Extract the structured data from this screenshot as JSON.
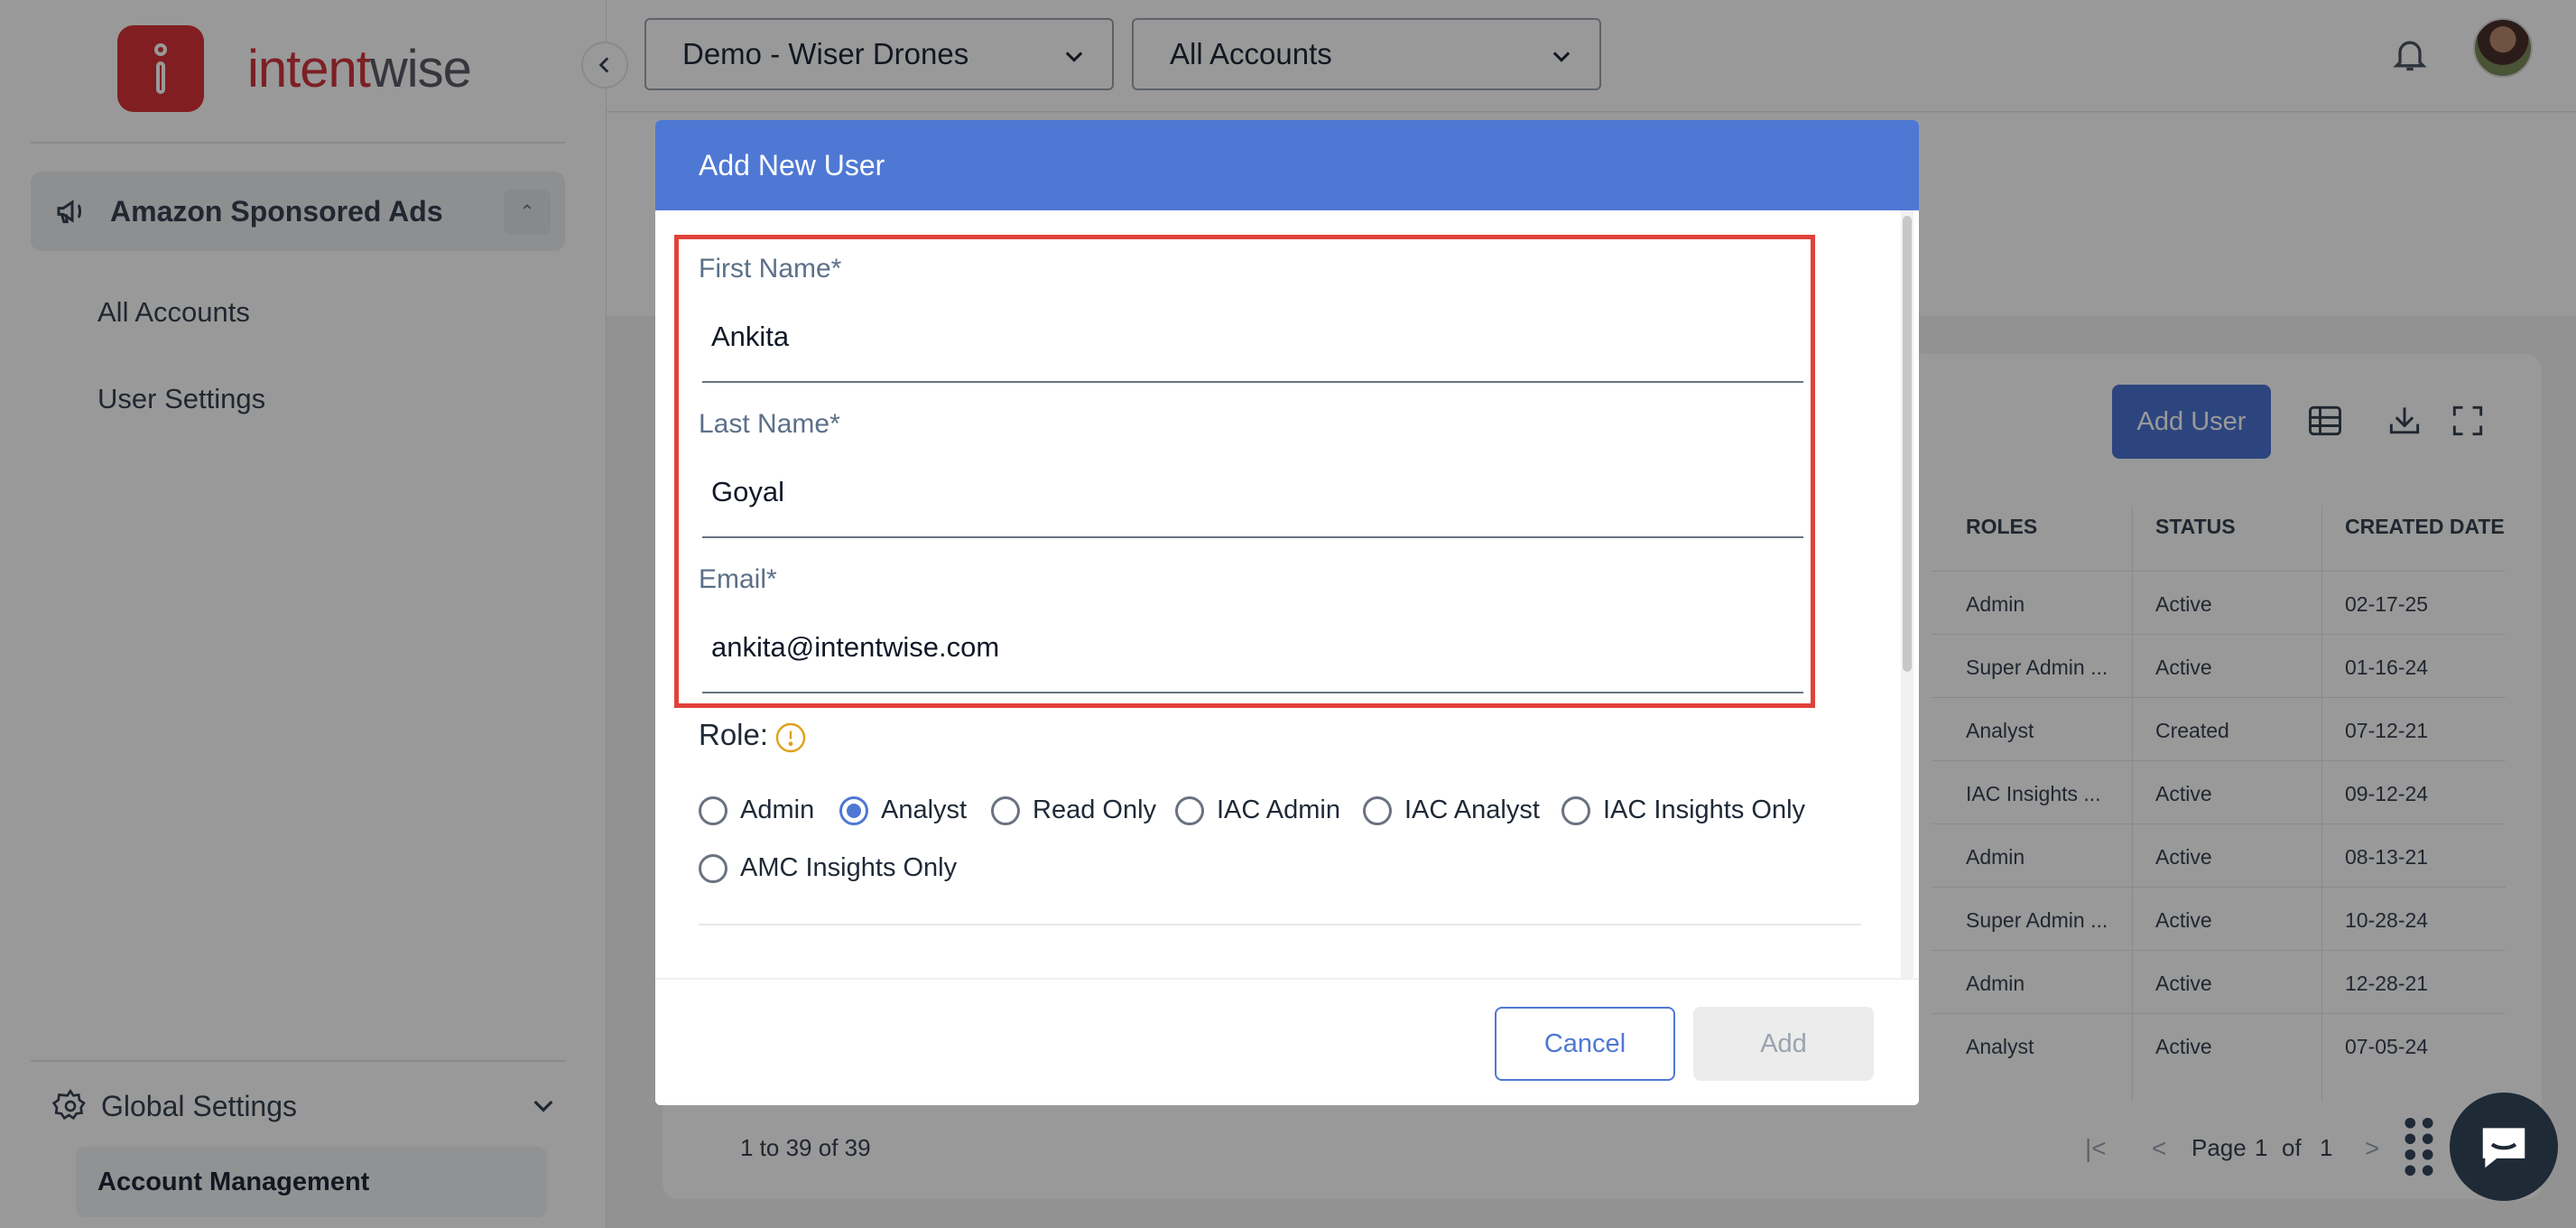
{
  "brand": {
    "name_part1": "intent",
    "name_part2": "wise",
    "accent": "#d8323a"
  },
  "sidebar": {
    "product": "Amazon Sponsored Ads",
    "links": [
      "All Accounts",
      "User Settings"
    ],
    "global_settings": "Global Settings",
    "active_item": "Account Management"
  },
  "topbar": {
    "profile_select": "Demo - Wiser Drones",
    "accounts_select": "All Accounts"
  },
  "table": {
    "add_user": "Add User",
    "headers": [
      "ROLES",
      "STATUS",
      "CREATED DATE"
    ],
    "rows": [
      [
        "Admin",
        "Active",
        "02-17-25"
      ],
      [
        "Super Admin ...",
        "Active",
        "01-16-24"
      ],
      [
        "Analyst",
        "Created",
        "07-12-21"
      ],
      [
        "IAC Insights ...",
        "Active",
        "09-12-24"
      ],
      [
        "Admin",
        "Active",
        "08-13-21"
      ],
      [
        "Super Admin ...",
        "Active",
        "10-28-24"
      ],
      [
        "Admin",
        "Active",
        "12-28-21"
      ],
      [
        "Analyst",
        "Active",
        "07-05-24"
      ]
    ],
    "range": "1 to 39 of 39",
    "page_label": "Page",
    "page_current": "1",
    "page_of": "of",
    "page_total": "1"
  },
  "modal": {
    "title": "Add New User",
    "first_name_label": "First Name*",
    "first_name_value": "Ankita",
    "last_name_label": "Last Name*",
    "last_name_value": "Goyal",
    "email_label": "Email*",
    "email_value": "ankita@intentwise.com",
    "role_label": "Role:",
    "roles": [
      "Admin",
      "Analyst",
      "Read Only",
      "IAC Admin",
      "IAC Analyst",
      "IAC Insights Only",
      "AMC Insights Only"
    ],
    "selected_role": "Analyst",
    "cancel": "Cancel",
    "add": "Add"
  }
}
